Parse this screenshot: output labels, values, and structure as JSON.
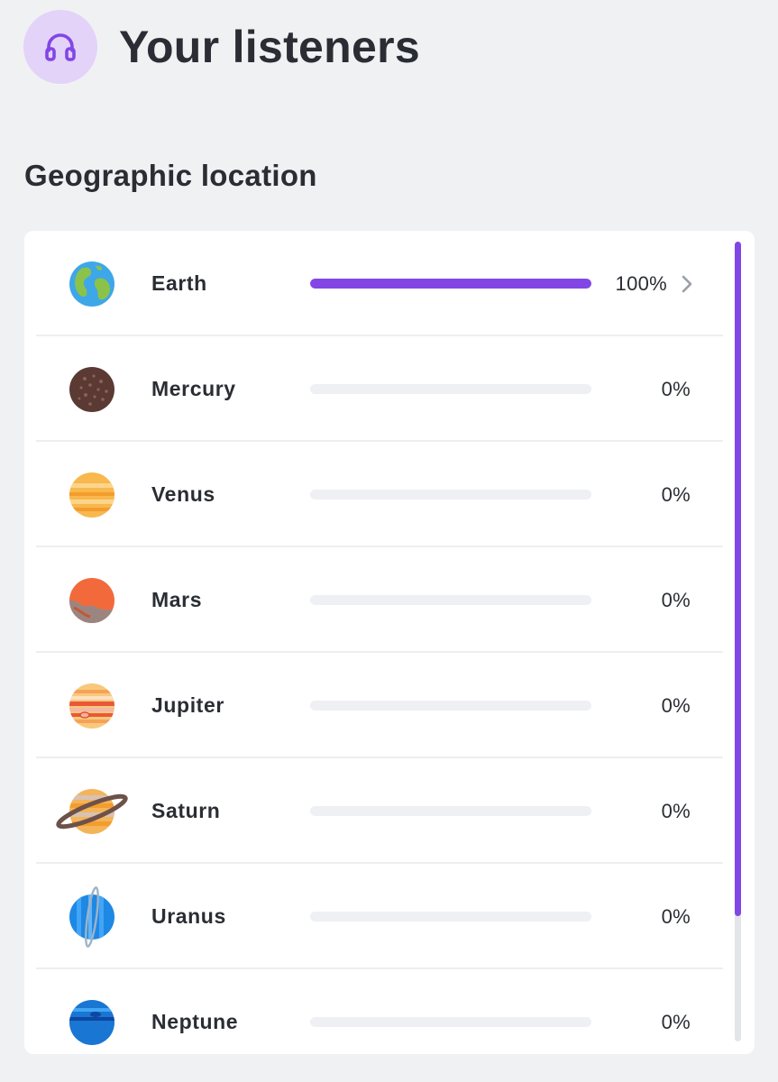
{
  "header": {
    "title": "Your listeners",
    "icon": "headphones-icon",
    "icon_color": "#8246e6",
    "icon_bg": "#e3d3f8"
  },
  "section": {
    "title": "Geographic location"
  },
  "accent_color": "#8246e6",
  "locations": [
    {
      "name": "Earth",
      "percent": 100,
      "value": "100%",
      "icon": "earth-icon",
      "expandable": true
    },
    {
      "name": "Mercury",
      "percent": 0,
      "value": "0%",
      "icon": "mercury-icon",
      "expandable": false
    },
    {
      "name": "Venus",
      "percent": 0,
      "value": "0%",
      "icon": "venus-icon",
      "expandable": false
    },
    {
      "name": "Mars",
      "percent": 0,
      "value": "0%",
      "icon": "mars-icon",
      "expandable": false
    },
    {
      "name": "Jupiter",
      "percent": 0,
      "value": "0%",
      "icon": "jupiter-icon",
      "expandable": false
    },
    {
      "name": "Saturn",
      "percent": 0,
      "value": "0%",
      "icon": "saturn-icon",
      "expandable": false
    },
    {
      "name": "Uranus",
      "percent": 0,
      "value": "0%",
      "icon": "uranus-icon",
      "expandable": false
    },
    {
      "name": "Neptune",
      "percent": 0,
      "value": "0%",
      "icon": "neptune-icon",
      "expandable": false
    }
  ]
}
